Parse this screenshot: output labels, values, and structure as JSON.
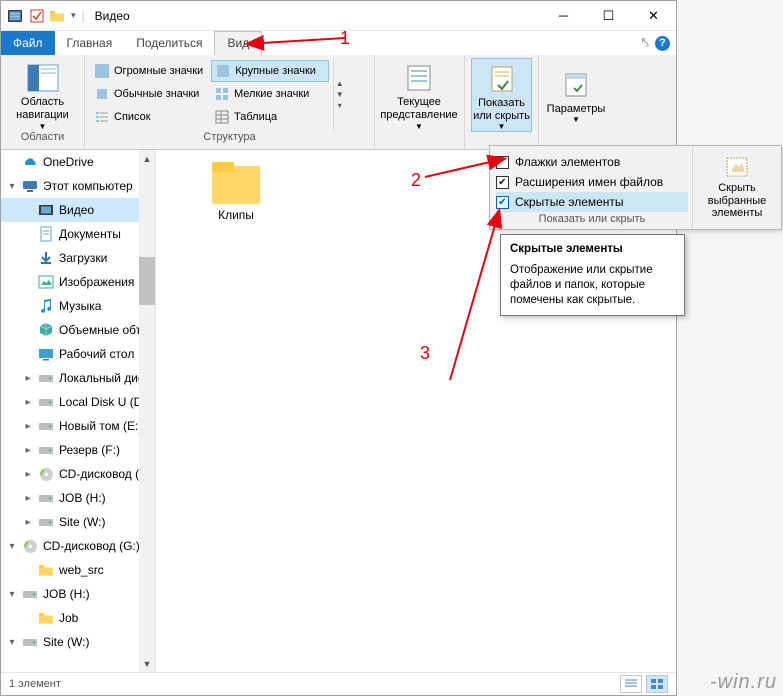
{
  "title": "Видео",
  "tabs": {
    "file": "Файл",
    "home": "Главная",
    "share": "Поделиться",
    "view": "Вид"
  },
  "ribbon": {
    "nav": {
      "btn": "Область навигации",
      "group": "Области"
    },
    "layout": {
      "group": "Структура",
      "huge": "Огромные значки",
      "large": "Крупные значки",
      "medium": "Обычные значки",
      "small": "Мелкие значки",
      "list": "Список",
      "table": "Таблица"
    },
    "current": "Текущее представление",
    "show": "Показать или скрыть",
    "params": "Параметры"
  },
  "popup": {
    "checks": [
      "Флажки элементов",
      "Расширения имен файлов",
      "Скрытые элементы"
    ],
    "states": [
      false,
      true,
      true
    ],
    "group": "Показать или скрыть",
    "side": "Скрыть выбранные элементы"
  },
  "tooltip": {
    "title": "Скрытые элементы",
    "body": "Отображение или скрытие файлов и папок, которые помечены как скрытые."
  },
  "tree": [
    {
      "t": "OneDrive",
      "icon": "cloud",
      "ind": 0,
      "exp": ""
    },
    {
      "t": "Этот компьютер",
      "icon": "pc",
      "ind": 0,
      "exp": "▾"
    },
    {
      "t": "Видео",
      "icon": "video",
      "ind": 1,
      "sel": true
    },
    {
      "t": "Документы",
      "icon": "doc",
      "ind": 1
    },
    {
      "t": "Загрузки",
      "icon": "down",
      "ind": 1
    },
    {
      "t": "Изображения",
      "icon": "img",
      "ind": 1
    },
    {
      "t": "Музыка",
      "icon": "music",
      "ind": 1
    },
    {
      "t": "Объемные объ",
      "icon": "3d",
      "ind": 1
    },
    {
      "t": "Рабочий стол",
      "icon": "desk",
      "ind": 1
    },
    {
      "t": "Локальный дис",
      "icon": "hdd",
      "ind": 1,
      "exp": "▸"
    },
    {
      "t": "Local Disk U (D:)",
      "icon": "hdd",
      "ind": 1,
      "exp": "▸"
    },
    {
      "t": "Новый том (E:)",
      "icon": "hdd",
      "ind": 1,
      "exp": "▸"
    },
    {
      "t": "Резерв (F:)",
      "icon": "hdd",
      "ind": 1,
      "exp": "▸"
    },
    {
      "t": "CD-дисковод (G",
      "icon": "cd",
      "ind": 1,
      "exp": "▸"
    },
    {
      "t": "JOB (H:)",
      "icon": "hdd",
      "ind": 1,
      "exp": "▸"
    },
    {
      "t": "Site (W:)",
      "icon": "hdd",
      "ind": 1,
      "exp": "▸"
    },
    {
      "t": "CD-дисковод (G:)",
      "icon": "cd",
      "ind": 0,
      "exp": "▾"
    },
    {
      "t": "web_src",
      "icon": "folder",
      "ind": 1
    },
    {
      "t": "JOB (H:)",
      "icon": "hdd",
      "ind": 0,
      "exp": "▾"
    },
    {
      "t": "Job",
      "icon": "folder",
      "ind": 1
    },
    {
      "t": "Site (W:)",
      "icon": "hdd",
      "ind": 0,
      "exp": "▾"
    }
  ],
  "content_item": "Клипы",
  "status": "1 элемент",
  "annos": {
    "n1": "1",
    "n2": "2",
    "n3": "3"
  },
  "watermark": "-win.ru"
}
